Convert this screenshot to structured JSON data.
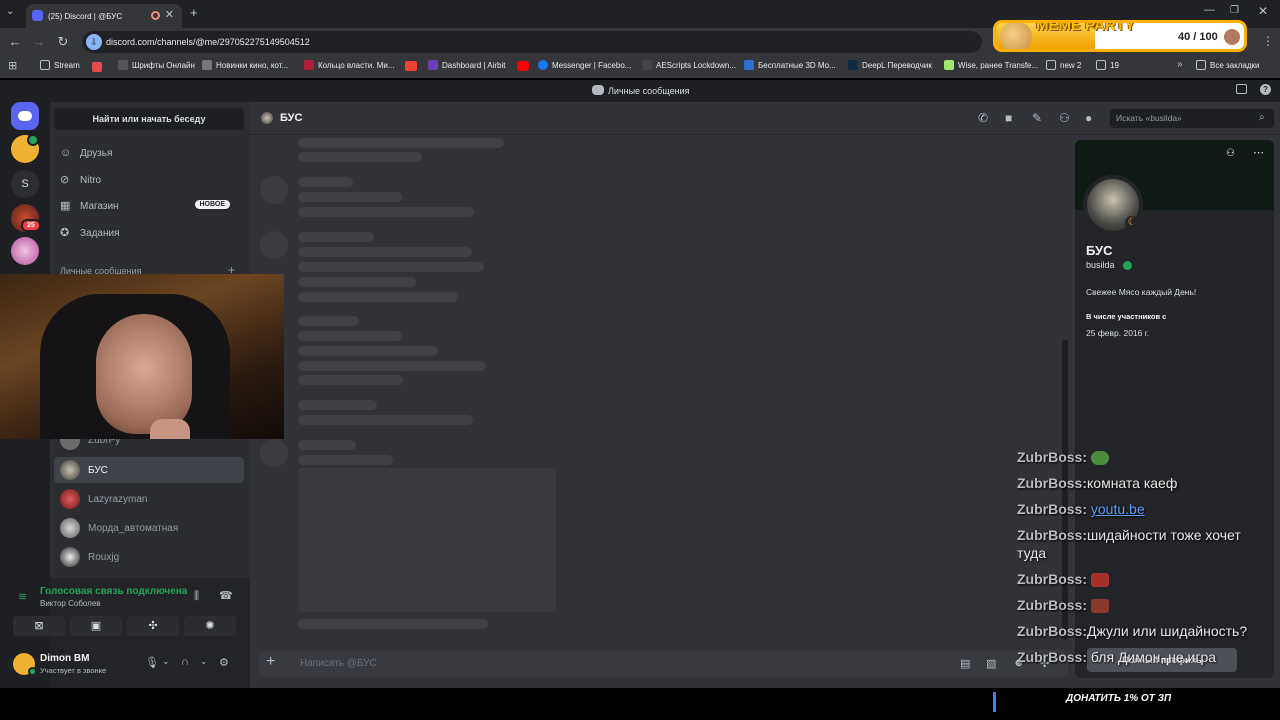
{
  "browser": {
    "tab_title": "(25) Discord | @БУС",
    "url": "discord.com/channels/@me/297052275149504512",
    "bookmarks": [
      "Stream",
      "Шрифты Онлайн",
      "Новинки кино, кот...",
      "Кольцо власти. Ми...",
      "Dashboard | Airbit",
      "Messenger | Facebo...",
      "AEScripts Lockdown...",
      "Бесплатные 3D Mo...",
      "DeepL Переводчик",
      "Wise, ранее Transfe...",
      "new 2",
      "19"
    ],
    "all_bookmarks": "Все закладки"
  },
  "discord": {
    "window_title": "Личные сообщения",
    "find_button": "Найти или начать беседу",
    "nav": [
      "Друзья",
      "Nitro",
      "Магазин",
      "Задания"
    ],
    "new_badge": "НОВОЕ",
    "dm_header": "Личные сообщения",
    "dms": [
      "ZubrPy",
      "БУС",
      "Lazyrazyman",
      "Морда_автоматная",
      "Rouxjg"
    ],
    "guild_badge": "25",
    "guild_letter": "S",
    "chat": {
      "name": "БУС",
      "search_placeholder": "Искать «busilda»",
      "input_placeholder": "Написать @БУС"
    },
    "voice": {
      "status": "Голосовая связь подключена",
      "channel": "Виктор Соболев"
    },
    "user": {
      "name": "Dimon BM",
      "status": "Участвует в звонке"
    },
    "profile": {
      "display_name": "БУС",
      "username": "busilda",
      "bio": "Свежее Мясо каждый День!",
      "member_since_label": "В числе участников с",
      "member_since": "25 февр. 2016 г.",
      "full_profile_button": "Полный профиль"
    }
  },
  "overlay": {
    "meme_title": "MEME PARTY",
    "meme_count": "40 / 100",
    "meme_progress": 0.4,
    "donate": "ДОНАТИТЬ 1% ОТ ЗП",
    "chat": [
      {
        "user": "ZubrBoss:",
        "text": ""
      },
      {
        "user": "ZubrBoss:",
        "text": "комната каеф"
      },
      {
        "user": "ZubrBoss:",
        "text": "youtu.be"
      },
      {
        "user": "ZubrBoss:",
        "text": "шидайности тоже хочет туда"
      },
      {
        "user": "ZubrBoss:",
        "text": ""
      },
      {
        "user": "ZubrBoss:",
        "text": ""
      },
      {
        "user": "ZubrBoss:",
        "text": "Джули или шидайность?"
      },
      {
        "user": "ZubrBoss:",
        "text": "бля Димон, не игра"
      }
    ]
  }
}
